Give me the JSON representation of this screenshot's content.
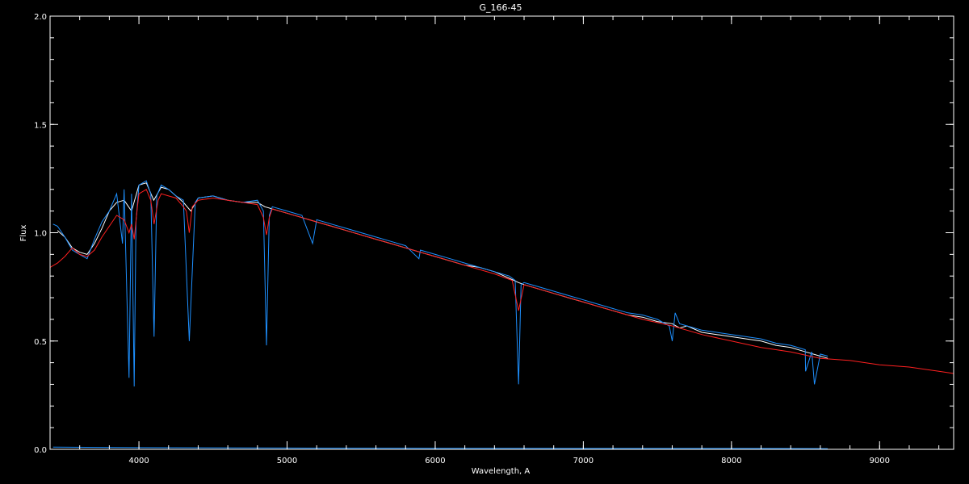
{
  "chart_data": {
    "type": "line",
    "title": "G_166-45",
    "xlabel": "Wavelength, A",
    "ylabel": "Flux",
    "xlim": [
      3400,
      9500
    ],
    "ylim": [
      0.0,
      2.0
    ],
    "x_ticks": [
      4000,
      5000,
      6000,
      7000,
      8000,
      9000
    ],
    "x_tick_labels": [
      "4000",
      "5000",
      "6000",
      "7000",
      "8000",
      "9000"
    ],
    "x_minor_step": 200,
    "y_ticks": [
      0.0,
      0.5,
      1.0,
      1.5,
      2.0
    ],
    "y_tick_labels": [
      "0.0",
      "0.5",
      "1.0",
      "1.5",
      "2.0"
    ],
    "y_minor_step": 0.1,
    "grid": false,
    "background": "#000000",
    "foreground": "#ffffff",
    "series": [
      {
        "color": "#ffffff",
        "x": [
          3450,
          3500,
          3550,
          3600,
          3650,
          3700,
          3750,
          3800,
          3850,
          3900,
          3950,
          4000,
          4050,
          4100,
          4150,
          4200,
          4250,
          4300,
          4350,
          4400,
          4500,
          4600,
          4700,
          4800,
          4850,
          4900,
          5000,
          5100,
          5200,
          5300,
          5400,
          5500,
          5600,
          5700,
          5800,
          5900,
          6000,
          6100,
          6200,
          6300,
          6400,
          6500,
          6563,
          6600,
          6700,
          6800,
          6900,
          7000,
          7100,
          7200,
          7300,
          7400,
          7500,
          7600,
          7650,
          7700,
          7800,
          7900,
          8000,
          8100,
          8200,
          8300,
          8400,
          8500,
          8600,
          8650
        ],
        "y": [
          1.01,
          0.98,
          0.93,
          0.91,
          0.9,
          0.95,
          1.02,
          1.1,
          1.14,
          1.15,
          1.1,
          1.22,
          1.23,
          1.15,
          1.21,
          1.2,
          1.17,
          1.14,
          1.1,
          1.16,
          1.17,
          1.15,
          1.14,
          1.14,
          1.12,
          1.11,
          1.09,
          1.07,
          1.05,
          1.03,
          1.01,
          0.99,
          0.97,
          0.95,
          0.93,
          0.91,
          0.89,
          0.87,
          0.85,
          0.84,
          0.82,
          0.79,
          0.77,
          0.76,
          0.74,
          0.72,
          0.7,
          0.68,
          0.66,
          0.64,
          0.62,
          0.61,
          0.59,
          0.58,
          0.56,
          0.57,
          0.54,
          0.53,
          0.52,
          0.51,
          0.5,
          0.48,
          0.47,
          0.45,
          0.43,
          0.42
        ]
      },
      {
        "color": "#1e90ff",
        "x": [
          3420,
          3450,
          3500,
          3550,
          3600,
          3650,
          3700,
          3750,
          3800,
          3850,
          3889,
          3900,
          3933,
          3950,
          3968,
          3980,
          4000,
          4050,
          4080,
          4102,
          4120,
          4150,
          4200,
          4250,
          4300,
          4340,
          4380,
          4400,
          4500,
          4600,
          4700,
          4800,
          4840,
          4861,
          4880,
          4900,
          5000,
          5100,
          5172,
          5200,
          5300,
          5400,
          5500,
          5600,
          5700,
          5800,
          5890,
          5900,
          6000,
          6100,
          6200,
          6300,
          6400,
          6500,
          6540,
          6563,
          6580,
          6600,
          6700,
          6800,
          6900,
          7000,
          7100,
          7200,
          7300,
          7400,
          7500,
          7580,
          7600,
          7620,
          7650,
          7700,
          7800,
          7900,
          8000,
          8100,
          8200,
          8300,
          8400,
          8498,
          8500,
          8542,
          8560,
          8600,
          8650
        ],
        "y": [
          1.04,
          1.03,
          0.98,
          0.92,
          0.9,
          0.88,
          0.97,
          1.05,
          1.1,
          1.18,
          0.95,
          1.2,
          0.33,
          1.18,
          0.29,
          1.05,
          1.22,
          1.24,
          1.18,
          0.52,
          1.17,
          1.22,
          1.2,
          1.17,
          1.15,
          0.5,
          1.14,
          1.16,
          1.17,
          1.15,
          1.14,
          1.15,
          1.1,
          0.48,
          1.08,
          1.12,
          1.1,
          1.08,
          0.95,
          1.06,
          1.04,
          1.02,
          1.0,
          0.98,
          0.96,
          0.94,
          0.88,
          0.92,
          0.9,
          0.88,
          0.86,
          0.84,
          0.82,
          0.8,
          0.78,
          0.3,
          0.76,
          0.77,
          0.75,
          0.73,
          0.71,
          0.69,
          0.67,
          0.65,
          0.63,
          0.62,
          0.6,
          0.57,
          0.5,
          0.63,
          0.58,
          0.57,
          0.55,
          0.54,
          0.53,
          0.52,
          0.51,
          0.49,
          0.48,
          0.46,
          0.36,
          0.45,
          0.3,
          0.44,
          0.43
        ]
      },
      {
        "color": "#ff2020",
        "x": [
          3400,
          3450,
          3500,
          3550,
          3600,
          3650,
          3700,
          3750,
          3800,
          3850,
          3900,
          3933,
          3950,
          3968,
          3990,
          4000,
          4050,
          4080,
          4102,
          4130,
          4150,
          4200,
          4250,
          4300,
          4320,
          4340,
          4360,
          4400,
          4500,
          4600,
          4700,
          4800,
          4840,
          4861,
          4880,
          4900,
          5000,
          5200,
          5400,
          5600,
          5800,
          6000,
          6200,
          6400,
          6520,
          6563,
          6600,
          6800,
          7000,
          7200,
          7400,
          7600,
          7800,
          8000,
          8200,
          8400,
          8600,
          8800,
          9000,
          9200,
          9400,
          9500
        ],
        "y": [
          0.84,
          0.86,
          0.89,
          0.93,
          0.9,
          0.89,
          0.92,
          0.98,
          1.03,
          1.08,
          1.06,
          1.0,
          1.04,
          0.97,
          1.12,
          1.18,
          1.2,
          1.15,
          1.04,
          1.15,
          1.18,
          1.17,
          1.16,
          1.12,
          1.1,
          1.0,
          1.12,
          1.15,
          1.16,
          1.15,
          1.14,
          1.13,
          1.07,
          0.99,
          1.07,
          1.11,
          1.09,
          1.05,
          1.01,
          0.97,
          0.93,
          0.89,
          0.85,
          0.81,
          0.78,
          0.64,
          0.76,
          0.72,
          0.68,
          0.64,
          0.6,
          0.57,
          0.53,
          0.5,
          0.47,
          0.45,
          0.42,
          0.41,
          0.39,
          0.38,
          0.36,
          0.35
        ]
      },
      {
        "color": "#1e90ff",
        "x": [
          3420,
          4000,
          5000,
          6000,
          7000,
          8000,
          8650
        ],
        "y": [
          0.01,
          0.008,
          0.006,
          0.005,
          0.004,
          0.004,
          0.003
        ]
      }
    ]
  }
}
